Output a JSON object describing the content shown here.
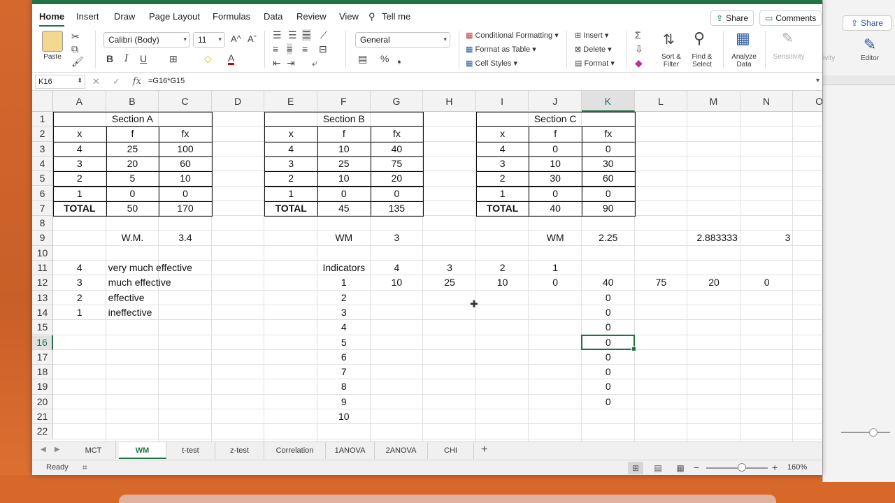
{
  "ribbon_tabs": [
    "Home",
    "Insert",
    "Draw",
    "Page Layout",
    "Formulas",
    "Data",
    "Review",
    "View",
    "Tell me"
  ],
  "share_label": "Share",
  "comments_label": "Comments",
  "ribbon": {
    "paste_label": "Paste",
    "font_name": "Calibri (Body)",
    "font_size": "11",
    "number_format": "General",
    "conditional_formatting": "Conditional Formatting",
    "format_as_table": "Format as Table",
    "cell_styles": "Cell Styles",
    "insert": "Insert",
    "delete": "Delete",
    "format": "Format",
    "sort_filter_1": "Sort &",
    "sort_filter_2": "Filter",
    "find_select_1": "Find &",
    "find_select_2": "Select",
    "analyze_1": "Analyze",
    "analyze_2": "Data",
    "sensitivity": "Sensitivity",
    "bold": "B",
    "italic": "I",
    "underline": "U"
  },
  "background_window": {
    "share_label": "Share",
    "editor_label": "Editor",
    "sensitivity_partial": "ivity"
  },
  "formula_bar": {
    "name_box": "K16",
    "fx": "fx",
    "formula": "=G16*G15"
  },
  "columns": [
    "A",
    "B",
    "C",
    "D",
    "E",
    "F",
    "G",
    "H",
    "I",
    "J",
    "K",
    "L",
    "M",
    "N",
    "O"
  ],
  "rows": [
    "1",
    "2",
    "3",
    "4",
    "5",
    "6",
    "7",
    "8",
    "9",
    "10",
    "11",
    "12",
    "13",
    "14",
    "15",
    "16",
    "17",
    "18",
    "19",
    "20",
    "21",
    "22"
  ],
  "selected_cell": {
    "col": "K",
    "row": "16"
  },
  "cells": {
    "B1": "Section A",
    "F1": "Section B",
    "J1": "Section C",
    "A2": "x",
    "B2": "f",
    "C2": "fx",
    "E2": "x",
    "F2": "f",
    "G2": "fx",
    "I2": "x",
    "J2": "f",
    "K2": "fx",
    "A3": "4",
    "B3": "25",
    "C3": "100",
    "E3": "4",
    "F3": "10",
    "G3": "40",
    "I3": "4",
    "J3": "0",
    "K3": "0",
    "A4": "3",
    "B4": "20",
    "C4": "60",
    "E4": "3",
    "F4": "25",
    "G4": "75",
    "I4": "3",
    "J4": "10",
    "K4": "30",
    "A5": "2",
    "B5": "5",
    "C5": "10",
    "E5": "2",
    "F5": "10",
    "G5": "20",
    "I5": "2",
    "J5": "30",
    "K5": "60",
    "A6": "1",
    "B6": "0",
    "C6": "0",
    "E6": "1",
    "F6": "0",
    "G6": "0",
    "I6": "1",
    "J6": "0",
    "K6": "0",
    "A7": "TOTAL",
    "B7": "50",
    "C7": "170",
    "E7": "TOTAL",
    "F7": "45",
    "G7": "135",
    "I7": "TOTAL",
    "J7": "40",
    "K7": "90",
    "B9": "W.M.",
    "C9": "3.4",
    "F9": "WM",
    "G9": "3",
    "J9": "WM",
    "K9": "2.25",
    "M9": "2.883333",
    "N9": "3",
    "A11": "4",
    "B11": "very much effective",
    "F11": "Indicators",
    "G11": "4",
    "H11": "3",
    "I11": "2",
    "J11": "1",
    "A12": "3",
    "B12": "much effective",
    "F12": "1",
    "G12": "10",
    "H12": "25",
    "I12": "10",
    "J12": "0",
    "K12": "40",
    "L12": "75",
    "M12": "20",
    "N12": "0",
    "A13": "2",
    "B13": "effective",
    "F13": "2",
    "K13": "0",
    "A14": "1",
    "B14": "ineffective",
    "F14": "3",
    "K14": "0",
    "F15": "4",
    "K15": "0",
    "F16": "5",
    "K16": "0",
    "F17": "6",
    "K17": "0",
    "F18": "7",
    "K18": "0",
    "F19": "8",
    "K19": "0",
    "F20": "9",
    "K20": "0",
    "F21": "10"
  },
  "sheet_tabs": [
    "MCT",
    "WM",
    "t-test",
    "z-test",
    "Correlation",
    "1ANOVA",
    "2ANOVA",
    "CHI"
  ],
  "active_sheet": "WM",
  "status": {
    "ready": "Ready",
    "zoom": "160%"
  },
  "colors": {
    "accent": "#217346"
  }
}
